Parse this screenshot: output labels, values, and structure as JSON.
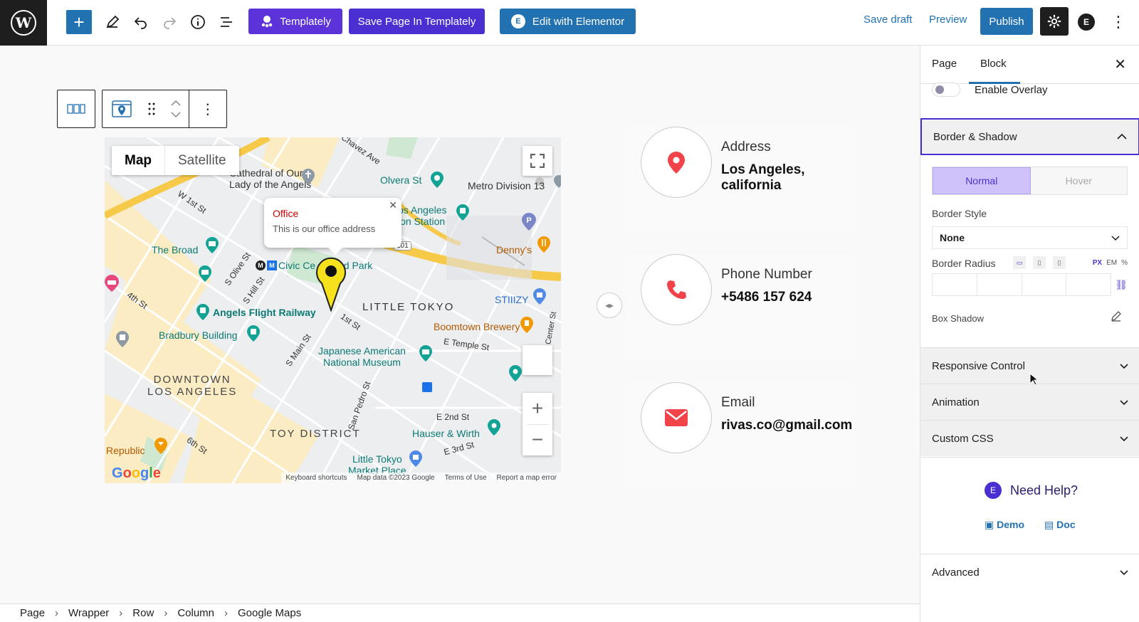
{
  "toolbar": {
    "templately_label": "Templately",
    "save_templately_label": "Save Page In Templately",
    "elementor_label": "Edit with Elementor",
    "save_draft_label": "Save draft",
    "preview_label": "Preview",
    "publish_label": "Publish"
  },
  "map": {
    "type_map": "Map",
    "type_satellite": "Satellite",
    "info_title": "Office",
    "info_text": "This is our office address",
    "footer_keyboard": "Keyboard shortcuts",
    "footer_data": "Map data ©2023 Google",
    "footer_terms": "Terms of Use",
    "footer_report": "Report a map error",
    "labels": {
      "cathedral": "Cathedral of Our",
      "lady": "Lady of the Angels",
      "olvera": "Olvera St",
      "metro": "Metro Division 13",
      "union1": "os Angeles",
      "union2": "ion Station",
      "the_broad": "The Broad",
      "dennys": "Denny's",
      "civic": "Civic Ce",
      "park": "nd Park",
      "little_tokyo": "LITTLE TOKYO",
      "stiiizy": "STIIIZY",
      "angels_flight": "Angels Flight Railway",
      "bradbury": "Bradbury Building",
      "boomtown": "Boomtown Brewery",
      "japanese1": "Japanese American",
      "japanese2": "National Museum",
      "downtown1": "DOWNTOWN",
      "downtown2": "LOS ANGELES",
      "toy": "TOY DISTRICT",
      "hauser": "Hauser & Wirth",
      "republic": "Republic",
      "little_tokyo_mp1": "Little Tokyo",
      "little_tokyo_mp2": "Market Place",
      "w1st": "W 1st St",
      "olive": "S Olive St",
      "hill": "S Hill St",
      "fourth": "4th St",
      "first": "1st St",
      "main": "S Main St",
      "pedro": "San Pedro St",
      "temple": "E Temple St",
      "e2nd": "E 2nd St",
      "e3rd": "E 3rd St",
      "sixth": "6th St",
      "chavez": "Chavez Ave",
      "center": "Center St",
      "hwy101": "101"
    }
  },
  "contacts": [
    {
      "label": "Address",
      "value": "Los Angeles, california",
      "icon": "location-pin-icon"
    },
    {
      "label": "Phone Number",
      "value": "+5486 157 624",
      "icon": "phone-icon"
    },
    {
      "label": "Email",
      "value": "rivas.co@gmail.com",
      "icon": "envelope-icon"
    }
  ],
  "breadcrumb": [
    "Page",
    "Wrapper",
    "Row",
    "Column",
    "Google Maps"
  ],
  "sidebar": {
    "tab_page": "Page",
    "tab_block": "Block",
    "enable_overlay": "Enable Overlay",
    "border_shadow": "Border & Shadow",
    "state_normal": "Normal",
    "state_hover": "Hover",
    "border_style_label": "Border Style",
    "border_style_value": "None",
    "border_radius_label": "Border Radius",
    "unit_px": "PX",
    "unit_em": "EM",
    "unit_pct": "%",
    "box_shadow_label": "Box Shadow",
    "responsive_control": "Responsive Control",
    "animation": "Animation",
    "custom_css": "Custom CSS",
    "need_help": "Need Help?",
    "demo": "Demo",
    "doc": "Doc",
    "advanced": "Advanced"
  },
  "colors": {
    "accent": "#2271b1",
    "templately": "#5b33d8",
    "contact_icon": "#f0434a"
  }
}
